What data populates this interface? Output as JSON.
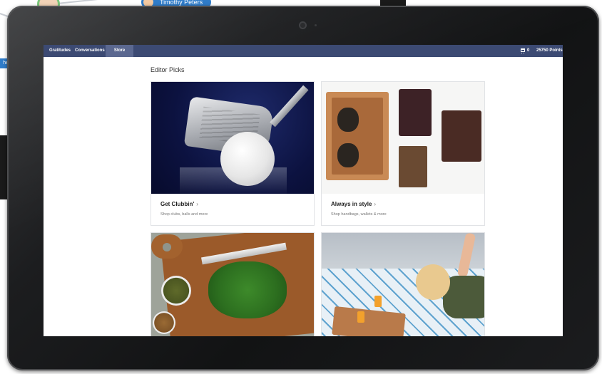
{
  "background": {
    "chip_name": "Timothy Peters",
    "left_tag_text": "he"
  },
  "app": {
    "nav": {
      "items": [
        "Gratitudes",
        "Conversations",
        "Store"
      ],
      "active": "Store",
      "cart_count": "0",
      "points": "25750 Points"
    },
    "section_title": "Editor Picks",
    "cards": [
      {
        "title": "Get Clubbin'",
        "chevron": "›",
        "subtitle": "Shop clubs, balls and more",
        "image": "golf-club-and-ball"
      },
      {
        "title": "Always in style",
        "chevron": "›",
        "subtitle": "Shop handbags, wallets & more",
        "image": "sunglasses-and-wallets"
      },
      {
        "title": "",
        "subtitle": "",
        "image": "cutting-board-with-herbs"
      },
      {
        "title": "",
        "subtitle": "",
        "image": "breakfast-in-bed"
      }
    ]
  },
  "colors": {
    "nav_bg": "#3c4a73",
    "nav_active": "#5b6890",
    "tablet_bezel": "#151617"
  }
}
